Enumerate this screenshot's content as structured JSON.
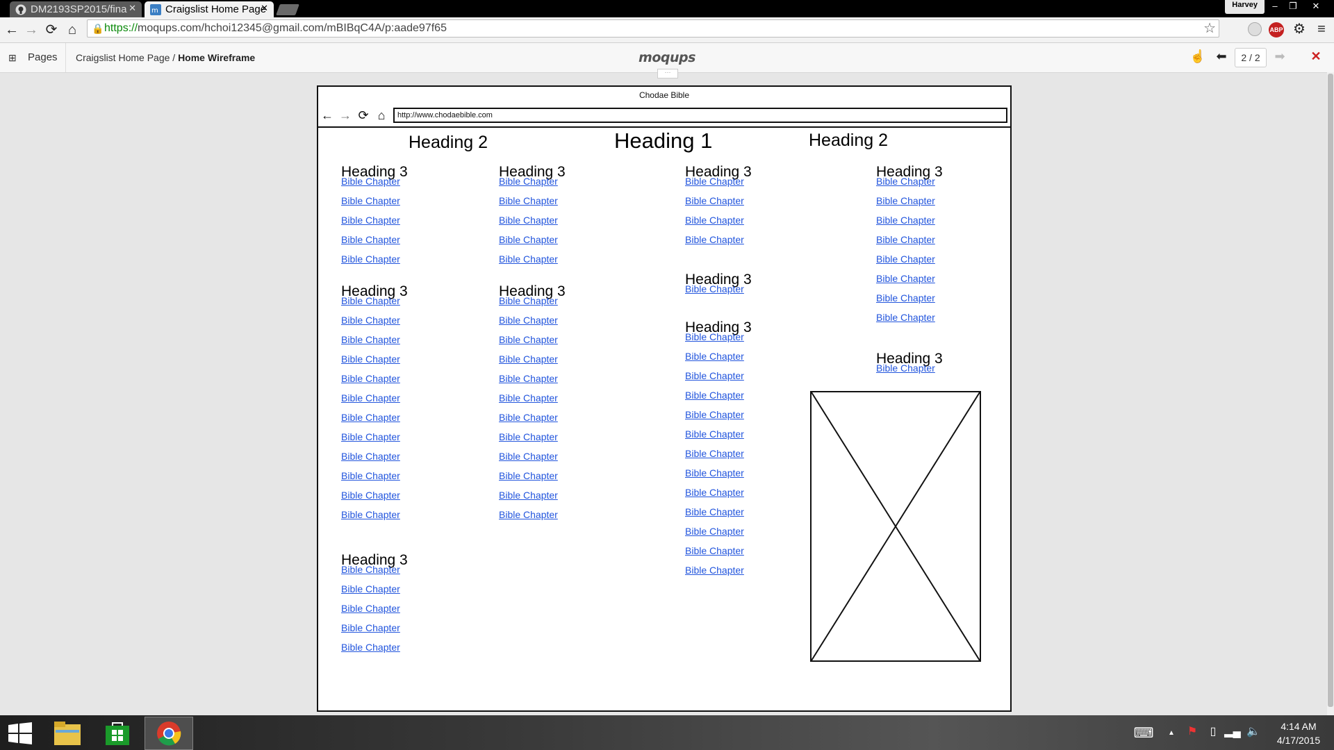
{
  "browser": {
    "tabs": [
      {
        "label": "DM2193SP2015/fina"
      },
      {
        "label": "Craigslist Home Page"
      }
    ],
    "profile": "Harvey",
    "window_controls": {
      "minimize": "–",
      "restore": "❐",
      "close": "✕"
    },
    "url_https": "https://",
    "url_rest": "moqups.com/hchoi12345@gmail.com/mBIBqC4A/p:aade97f65",
    "abp_label": "ABP"
  },
  "moqups": {
    "pages_label": "Pages",
    "breadcrumb_project": "Craigslist Home Page",
    "breadcrumb_sep": " / ",
    "breadcrumb_page": "Home Wireframe",
    "logo": "moqups",
    "page_count": "2 / 2",
    "handle": "···"
  },
  "wireframe": {
    "window_title": "Chodae Bible",
    "url": "http://www.chodaebible.com",
    "heading1": "Heading 1",
    "heading2_left": "Heading 2",
    "heading2_right": "Heading 2",
    "columns": [
      {
        "sections": [
          {
            "heading": "Heading 3",
            "links": [
              "Bible Chapter",
              "Bible Chapter",
              "Bible Chapter",
              "Bible Chapter",
              "Bible Chapter"
            ]
          },
          {
            "heading": "Heading 3",
            "links": [
              "Bible Chapter",
              "Bible Chapter",
              "Bible Chapter",
              "Bible Chapter",
              "Bible Chapter",
              "Bible Chapter",
              "Bible Chapter",
              "Bible Chapter",
              "Bible Chapter",
              "Bible Chapter",
              "Bible Chapter",
              "Bible Chapter"
            ]
          },
          {
            "heading": "Heading 3",
            "links": [
              "Bible Chapter",
              "Bible Chapter",
              "Bible Chapter",
              "Bible Chapter",
              "Bible Chapter"
            ]
          }
        ]
      },
      {
        "sections": [
          {
            "heading": "Heading 3",
            "links": [
              "Bible Chapter",
              "Bible Chapter",
              "Bible Chapter",
              "Bible Chapter",
              "Bible Chapter"
            ]
          },
          {
            "heading": "Heading 3",
            "links": [
              "Bible Chapter",
              "Bible Chapter",
              "Bible Chapter",
              "Bible Chapter",
              "Bible Chapter",
              "Bible Chapter",
              "Bible Chapter",
              "Bible Chapter",
              "Bible Chapter",
              "Bible Chapter",
              "Bible Chapter",
              "Bible Chapter"
            ]
          }
        ]
      },
      {
        "sections": [
          {
            "heading": "Heading 3",
            "links": [
              "Bible Chapter",
              "Bible Chapter",
              "Bible Chapter",
              "Bible Chapter"
            ]
          },
          {
            "heading": "Heading 3",
            "links": [
              "Bible Chapter"
            ]
          },
          {
            "heading": "Heading 3",
            "links": [
              "Bible Chapter",
              "Bible Chapter",
              "Bible Chapter",
              "Bible Chapter",
              "Bible Chapter",
              "Bible Chapter",
              "Bible Chapter",
              "Bible Chapter",
              "Bible Chapter",
              "Bible Chapter",
              "Bible Chapter",
              "Bible Chapter",
              "Bible Chapter"
            ]
          }
        ]
      },
      {
        "sections": [
          {
            "heading": "Heading 3",
            "links": [
              "Bible Chapter",
              "Bible Chapter",
              "Bible Chapter",
              "Bible Chapter",
              "Bible Chapter",
              "Bible Chapter",
              "Bible Chapter",
              "Bible Chapter"
            ]
          },
          {
            "heading": "Heading 3",
            "links": [
              "Bible Chapter"
            ]
          }
        ]
      }
    ]
  },
  "taskbar": {
    "time": "4:14 AM",
    "date": "4/17/2015"
  },
  "colors": {
    "link": "#2255dd",
    "accent_close": "#cc2222"
  }
}
